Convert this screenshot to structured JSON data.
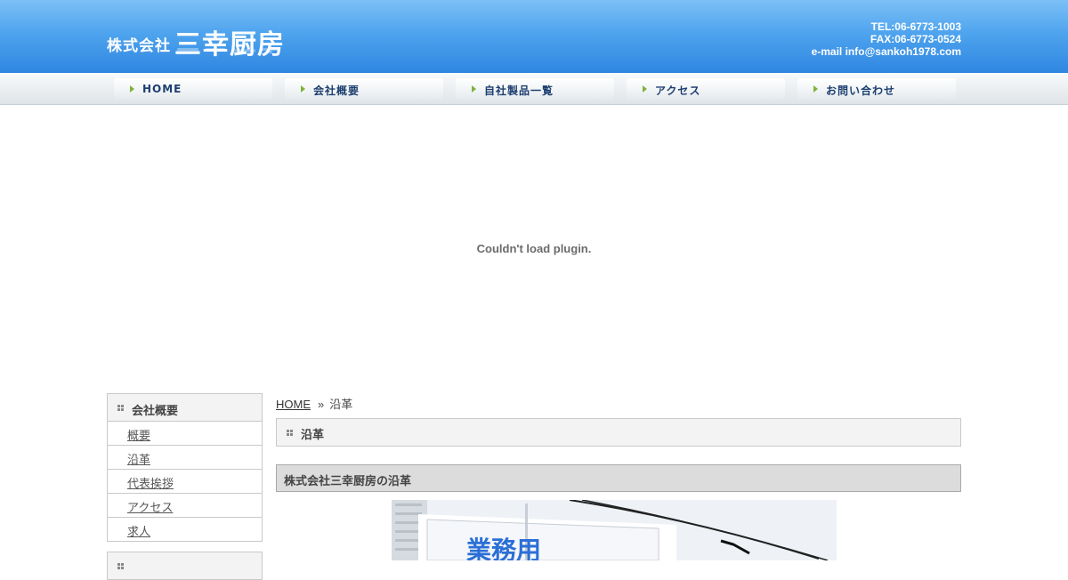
{
  "header": {
    "logo_prefix": "株式会社",
    "logo_name": "三幸厨房",
    "tel": "TEL:06-6773-1003",
    "fax": "FAX:06-6773-0524",
    "email": "e-mail info@sankoh1978.com"
  },
  "nav": {
    "items": [
      {
        "label": "HOME"
      },
      {
        "label": "会社概要"
      },
      {
        "label": "自社製品一覧"
      },
      {
        "label": "アクセス"
      },
      {
        "label": "お問い合わせ"
      }
    ]
  },
  "plugin": {
    "message": "Couldn't load plugin."
  },
  "sidebar": {
    "section1_title": "会社概要",
    "items": [
      {
        "label": "概要"
      },
      {
        "label": "沿革"
      },
      {
        "label": "代表挨拶"
      },
      {
        "label": "アクセス"
      },
      {
        "label": "求人"
      }
    ]
  },
  "breadcrumb": {
    "home": "HOME",
    "separator": "»",
    "current": "沿革"
  },
  "main": {
    "page_title": "沿革",
    "section_title": "株式会社三幸厨房の沿革",
    "photo_sign_text": "業務用"
  },
  "colors": {
    "header_top": "#7cc0f6",
    "header_bottom": "#2f86e0",
    "nav_text": "#1d3f70",
    "nav_arrow": "#7fb23a"
  }
}
